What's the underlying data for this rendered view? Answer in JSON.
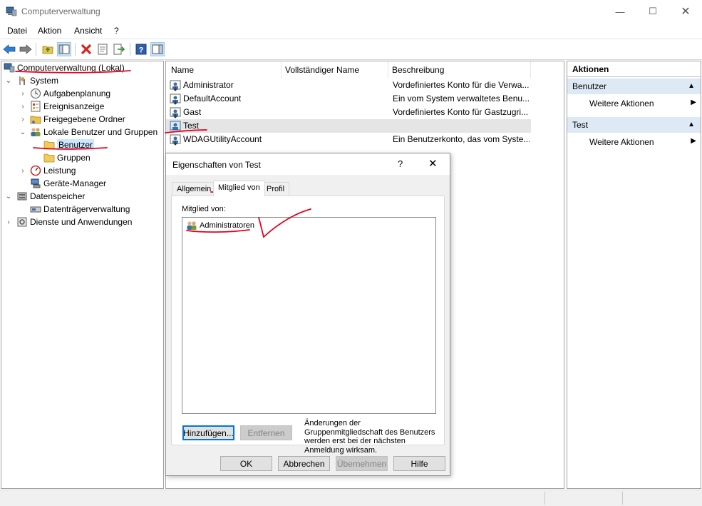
{
  "window": {
    "title": "Computerverwaltung"
  },
  "menu": {
    "items": [
      "Datei",
      "Aktion",
      "Ansicht",
      "?"
    ]
  },
  "tree": {
    "root": "Computerverwaltung (Lokal)",
    "system": "System",
    "aufgabenplanung": "Aufgabenplanung",
    "ereignisanzeige": "Ereignisanzeige",
    "freigegebene_ordner": "Freigegebene Ordner",
    "lokale_benutzer": "Lokale Benutzer und Gruppen",
    "benutzer": "Benutzer",
    "gruppen": "Gruppen",
    "leistung": "Leistung",
    "geraete_manager": "Geräte-Manager",
    "datenspeicher": "Datenspeicher",
    "datentraegerverwaltung": "Datenträgerverwaltung",
    "dienste": "Dienste und Anwendungen"
  },
  "list": {
    "columns": [
      "Name",
      "Vollständiger Name",
      "Beschreibung"
    ],
    "rows": [
      {
        "name": "Administrator",
        "fullname": "",
        "description": "Vordefiniertes Konto für die Verwa..."
      },
      {
        "name": "DefaultAccount",
        "fullname": "",
        "description": "Ein vom System verwaltetes Benu..."
      },
      {
        "name": "Gast",
        "fullname": "",
        "description": "Vordefiniertes Konto für Gastzugri..."
      },
      {
        "name": "Test",
        "fullname": "",
        "description": ""
      },
      {
        "name": "WDAGUtilityAccount",
        "fullname": "",
        "description": "Ein Benutzerkonto, das vom Syste..."
      }
    ]
  },
  "actions": {
    "header": "Aktionen",
    "section1": {
      "title": "Benutzer",
      "item": "Weitere Aktionen"
    },
    "section2": {
      "title": "Test",
      "item": "Weitere Aktionen"
    }
  },
  "dialog": {
    "title": "Eigenschaften von Test",
    "help": "?",
    "tabs": [
      "Allgemein",
      "Mitglied von",
      "Profil"
    ],
    "member_label": "Mitglied von:",
    "members": [
      "Administratoren"
    ],
    "add_button": "Hinzufügen...",
    "remove_button": "Entfernen",
    "note": "Änderungen der Gruppenmitgliedschaft des Benutzers werden erst bei der nächsten Anmeldung wirksam.",
    "ok": "OK",
    "cancel": "Abbrechen",
    "apply": "Übernehmen",
    "helpbtn": "Hilfe"
  },
  "icons": [
    "app-icon",
    "back-arrow-icon",
    "forward-arrow-icon",
    "folder-up-icon",
    "show-tree-icon",
    "delete-icon",
    "properties-icon",
    "export-icon",
    "help-icon",
    "action-pane-icon",
    "user-icon",
    "group-icon",
    "folder-icon",
    "clock-icon",
    "event-log-icon",
    "shared-folder-icon",
    "performance-icon",
    "device-manager-icon",
    "disk-icon",
    "services-icon",
    "computer-icon"
  ],
  "colors": {
    "annotation": "#e8001c",
    "selection": "#cce8ff",
    "action_header": "#dde9f5"
  }
}
